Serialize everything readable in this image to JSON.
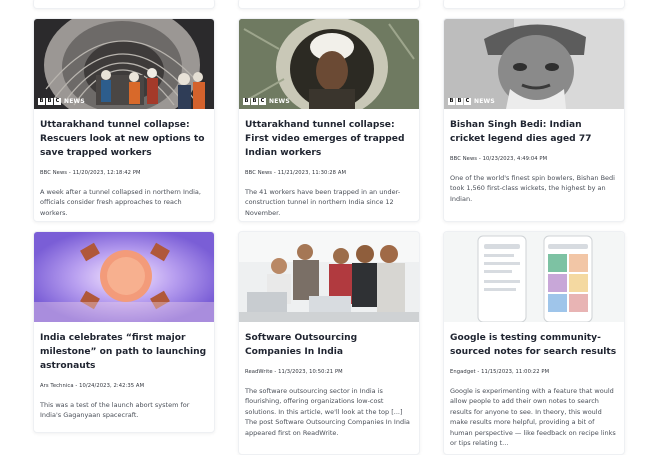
{
  "cards": [
    {
      "title": "Uttarakhand tunnel collapse: Rescuers look at new options to save trapped workers",
      "meta": "BBC News - 11/20/2023, 12:18:42 PM",
      "desc": "A week after a tunnel collapsed in northern India, officials consider fresh approaches to reach workers.",
      "badge": "NEWS"
    },
    {
      "title": "Uttarakhand tunnel collapse: First video emerges of trapped Indian workers",
      "meta": "BBC News - 11/21/2023, 11:30:28 AM",
      "desc": "The 41 workers have been trapped in an under-construction tunnel in northern India since 12 November.",
      "badge": "NEWS"
    },
    {
      "title": "Bishan Singh Bedi: Indian cricket legend dies aged 77",
      "meta": "BBC News - 10/23/2023, 4:49:04 PM",
      "desc": "One of the world's finest spin bowlers, Bishan Bedi took 1,560 first-class wickets, the highest by an Indian.",
      "badge": "NEWS"
    },
    {
      "title": "India celebrates “first major milestone” on path to launching astronauts",
      "meta": "Ars Technica - 10/24/2023, 2:42:35 AM",
      "desc": "This was a test of the launch abort system for India's Gaganyaan spacecraft."
    },
    {
      "title": "Software Outsourcing Companies In India",
      "meta": "ReadWrite - 11/3/2023, 10:50:21 PM",
      "desc": "The software outsourcing sector in India is flourishing, offering organizations low-cost solutions. In this article, we'll look at the top [...] The post Software Outsourcing Companies In India appeared first on ReadWrite."
    },
    {
      "title": "Google is testing community-sourced notes for search results",
      "meta": "Engadget - 11/15/2023, 11:00:22 PM",
      "desc": "Google is experimenting with a feature that would allow people to add their own notes to search results for anyone to see. In theory, this would make results more helpful, providing a bit of human perspective — like feedback on recipe links or tips relating t..."
    }
  ]
}
